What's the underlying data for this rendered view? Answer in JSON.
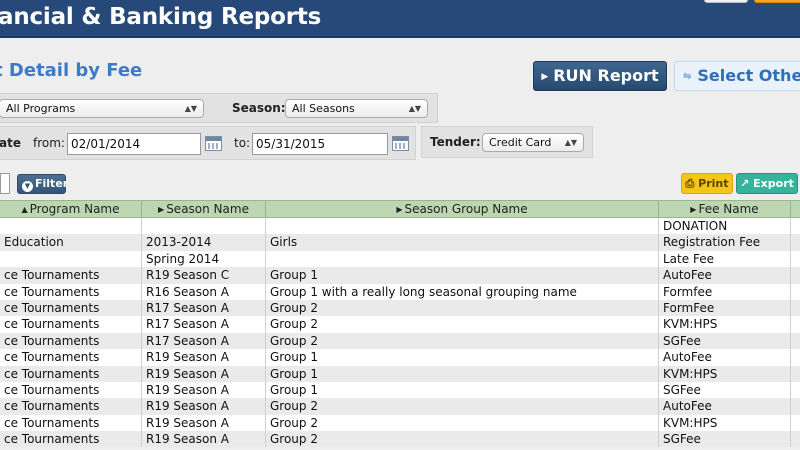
{
  "header": {
    "title": "ancial & Banking Reports"
  },
  "report": {
    "subtitle": "t Detail by Fee"
  },
  "actions": {
    "run_report": "RUN Report",
    "select_other": "Select Other"
  },
  "filters": {
    "program_value": "All Programs",
    "season_label": "Season:",
    "season_value": "All Seasons",
    "date_label": "ate",
    "from_label": "from:",
    "from_value": "02/01/2014",
    "to_label": "to:",
    "to_value": "05/31/2015",
    "tender_label": "Tender:",
    "tender_value": "Credit Card"
  },
  "toolbar": {
    "filter_label": "Filter",
    "print_label": "Print",
    "export_label": "Export"
  },
  "table": {
    "columns": [
      "Program Name",
      "Season Name",
      "Season Group Name",
      "Fee Name"
    ],
    "rows": [
      [
        "",
        "",
        "",
        "DONATION"
      ],
      [
        "Education",
        "2013-2014",
        "Girls",
        "Registration Fee"
      ],
      [
        "",
        "Spring 2014",
        "",
        "Late Fee"
      ],
      [
        "ce Tournaments",
        "R19 Season C",
        "Group 1",
        "AutoFee"
      ],
      [
        "ce Tournaments",
        "R16 Season A",
        "Group 1 with a really long seasonal grouping name",
        "Formfee"
      ],
      [
        "ce Tournaments",
        "R17 Season A",
        "Group 2",
        "FormFee"
      ],
      [
        "ce Tournaments",
        "R17 Season A",
        "Group 2",
        "KVM:HPS"
      ],
      [
        "ce Tournaments",
        "R17 Season A",
        "Group 2",
        "SGFee"
      ],
      [
        "ce Tournaments",
        "R19 Season A",
        "Group 1",
        "AutoFee"
      ],
      [
        "ce Tournaments",
        "R19 Season A",
        "Group 1",
        "KVM:HPS"
      ],
      [
        "ce Tournaments",
        "R19 Season A",
        "Group 1",
        "SGFee"
      ],
      [
        "ce Tournaments",
        "R19 Season A",
        "Group 2",
        "AutoFee"
      ],
      [
        "ce Tournaments",
        "R19 Season A",
        "Group 2",
        "KVM:HPS"
      ],
      [
        "ce Tournaments",
        "R19 Season A",
        "Group 2",
        "SGFee"
      ]
    ]
  }
}
